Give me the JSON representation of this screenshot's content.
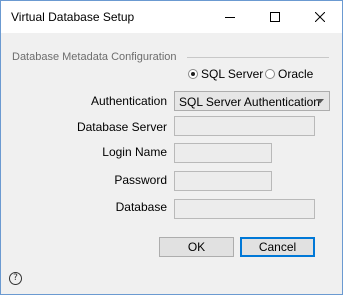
{
  "window": {
    "title": "Virtual Database Setup"
  },
  "group": {
    "label": "Database Metadata Configuration"
  },
  "database_type": {
    "options": [
      "SQL Server",
      "Oracle"
    ],
    "selected": "SQL Server"
  },
  "form": {
    "authentication": {
      "label": "Authentication",
      "value": "SQL Server Authentication"
    },
    "database_server": {
      "label": "Database Server",
      "value": ""
    },
    "login_name": {
      "label": "Login Name",
      "value": ""
    },
    "password": {
      "label": "Password",
      "value": ""
    },
    "database": {
      "label": "Database",
      "value": ""
    }
  },
  "buttons": {
    "ok": "OK",
    "cancel": "Cancel"
  },
  "help": {
    "glyph": "?"
  },
  "icons": {
    "minimize": "minimize-icon",
    "maximize": "maximize-icon",
    "close": "close-icon",
    "help": "help-icon",
    "dropdown": "chevron-down-icon"
  }
}
